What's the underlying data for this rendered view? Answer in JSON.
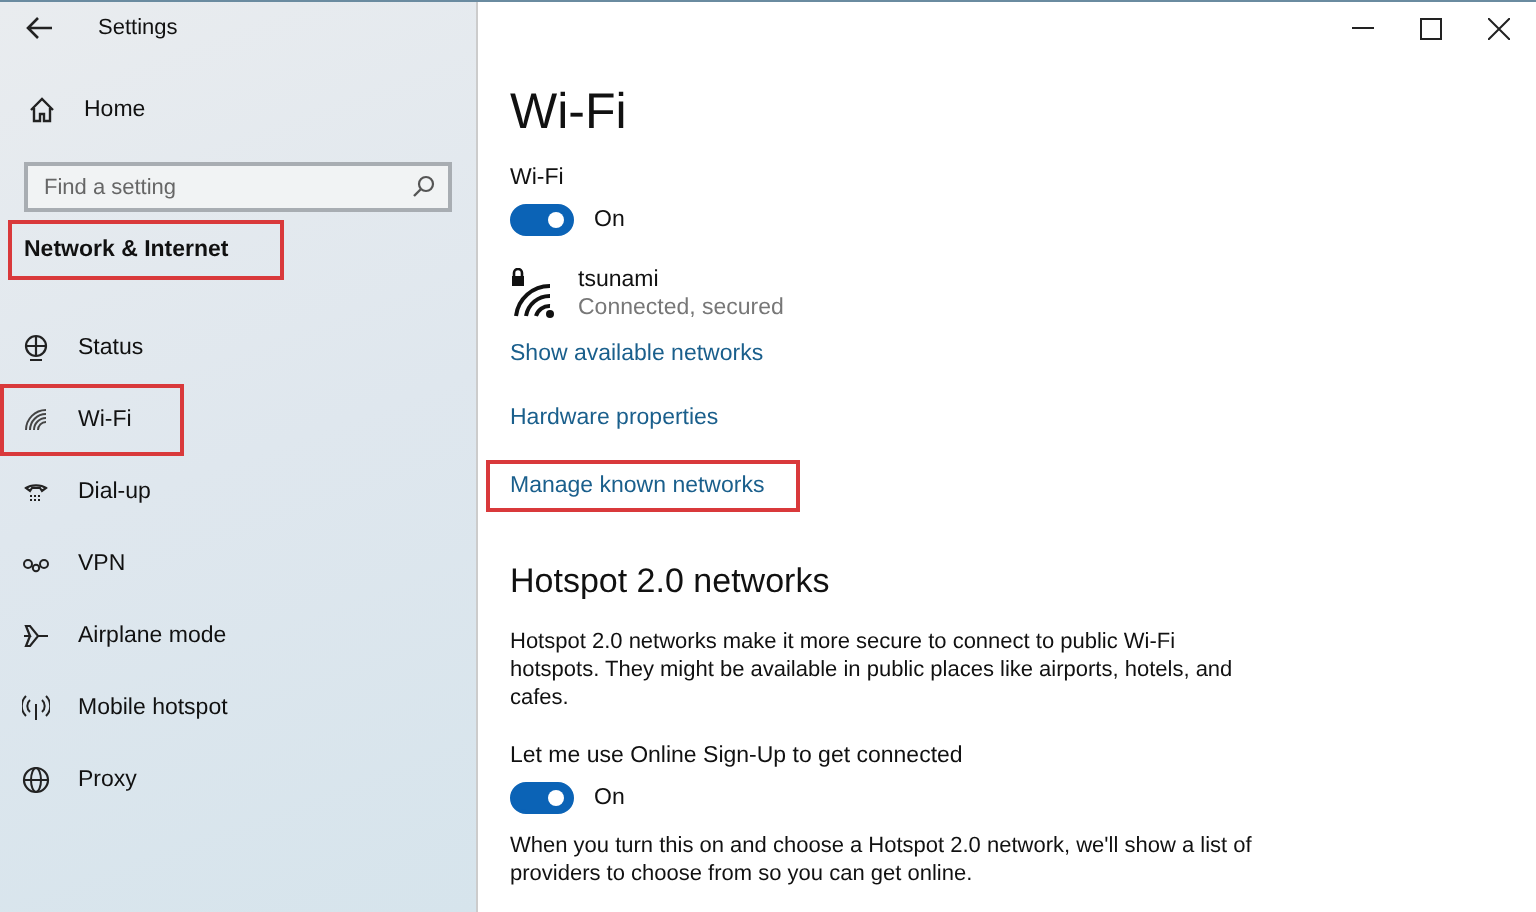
{
  "window": {
    "title": "Settings"
  },
  "sidebar": {
    "home": "Home",
    "search": {
      "placeholder": "Find a setting"
    },
    "section": {
      "label": "Network & Internet",
      "highlighted": true
    },
    "items": [
      {
        "label": "Status",
        "highlighted": false
      },
      {
        "label": "Wi-Fi",
        "highlighted": true
      },
      {
        "label": "Dial-up",
        "highlighted": false
      },
      {
        "label": "VPN",
        "highlighted": false
      },
      {
        "label": "Airplane mode",
        "highlighted": false
      },
      {
        "label": "Mobile hotspot",
        "highlighted": false
      },
      {
        "label": "Proxy",
        "highlighted": false
      }
    ]
  },
  "main": {
    "title": "Wi-Fi",
    "wifi_label": "Wi-Fi",
    "wifi_toggle": {
      "on": true,
      "text": "On"
    },
    "network": {
      "name": "tsunami",
      "status": "Connected, secured"
    },
    "links": [
      {
        "label": "Show available networks",
        "highlighted": false
      },
      {
        "label": "Hardware properties",
        "highlighted": false
      },
      {
        "label": "Manage known networks",
        "highlighted": true
      }
    ],
    "hotspot": {
      "heading": "Hotspot 2.0 networks",
      "description": "Hotspot 2.0 networks make it more secure to connect to public Wi-Fi hotspots. They might be available in public places like airports, hotels, and cafes.",
      "signup_label": "Let me use Online Sign-Up to get connected",
      "signup_toggle": {
        "on": true,
        "text": "On"
      },
      "note": "When you turn this on and choose a Hotspot 2.0 network, we'll show a list of providers to choose from so you can get online."
    }
  }
}
